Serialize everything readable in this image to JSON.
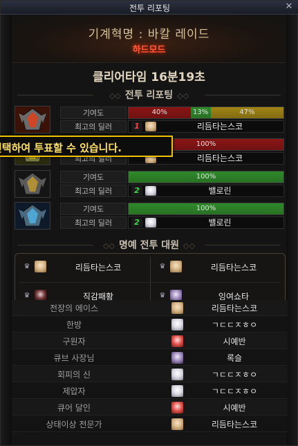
{
  "window": {
    "title": "전투 리포팅",
    "close_glyph": "✕"
  },
  "header": {
    "raid_name": "기계혁명 : 바칼 레이드",
    "difficulty": "하드모드"
  },
  "clear_time": "클리어타임  16분19초",
  "report_section_title": "전투 리포팅",
  "honor_section_title": "명예 전투 대원",
  "labels": {
    "contribution": "기여도",
    "best_dealer": "최고의 딜러"
  },
  "tooltip": "선택하여 투표할 수 있습니다.",
  "report_rows": [
    {
      "boss_icon": "red-boss-portrait-icon",
      "segments": [
        {
          "text": "40%",
          "percent": 40,
          "color": "#8a1414"
        },
        {
          "text": "13%",
          "percent": 13,
          "color": "#2f8a2a"
        },
        {
          "text": "47%",
          "percent": 47,
          "color": "#a08414"
        }
      ],
      "dealer_badge": "1",
      "dealer_badge_color": "#ff4040",
      "dealer_avatar": "av-blonde",
      "dealer": "리듬타는스코"
    },
    {
      "boss_icon": "gold-boss-portrait-icon",
      "segments": [
        {
          "text": "100%",
          "percent": 100,
          "color": "#8a1414"
        }
      ],
      "dealer_badge": "",
      "dealer_badge_color": "#ff4040",
      "dealer_avatar": "av-blonde",
      "dealer": "리듬타는스코"
    },
    {
      "boss_icon": "dark-boss-portrait-icon",
      "segments": [
        {
          "text": "100%",
          "percent": 100,
          "color": "#2f8a2a"
        }
      ],
      "dealer_badge": "2",
      "dealer_badge_color": "#3cd84a",
      "dealer_avatar": "av-white",
      "dealer": "밸로린"
    },
    {
      "boss_icon": "blue-boss-portrait-icon",
      "segments": [
        {
          "text": "100%",
          "percent": 100,
          "color": "#2f8a2a"
        }
      ],
      "dealer_badge": "2",
      "dealer_badge_color": "#3cd84a",
      "dealer_avatar": "av-white",
      "dealer": "밸로린"
    }
  ],
  "honor_members": [
    {
      "name": "리듬타는스코",
      "avatar": "av-blonde"
    },
    {
      "name": "리듬타는스코",
      "avatar": "av-blonde"
    },
    {
      "name": "직감패황",
      "avatar": "av-dark"
    },
    {
      "name": "잉여쇼타",
      "avatar": "av-purple"
    }
  ],
  "awards": [
    {
      "title": "전장의 에이스",
      "name": "리듬타는스코",
      "avatar": "av-blonde"
    },
    {
      "title": "한방",
      "name": "ㄱㄷㄷㅈㅎㅇ",
      "avatar": "av-white"
    },
    {
      "title": "구원자",
      "name": "시예반",
      "avatar": "av-red"
    },
    {
      "title": "큐브 사장님",
      "name": "록슬",
      "avatar": "av-purple"
    },
    {
      "title": "회피의 신",
      "name": "ㄱㄷㄷㅈㅎㅇ",
      "avatar": "av-white"
    },
    {
      "title": "제압자",
      "name": "ㄱㄷㄷㅈㅎㅇ",
      "avatar": "av-white"
    },
    {
      "title": "큐어 달인",
      "name": "시예반",
      "avatar": "av-red"
    },
    {
      "title": "상태이상 전문가",
      "name": "리듬타는스코",
      "avatar": "av-blonde"
    }
  ]
}
